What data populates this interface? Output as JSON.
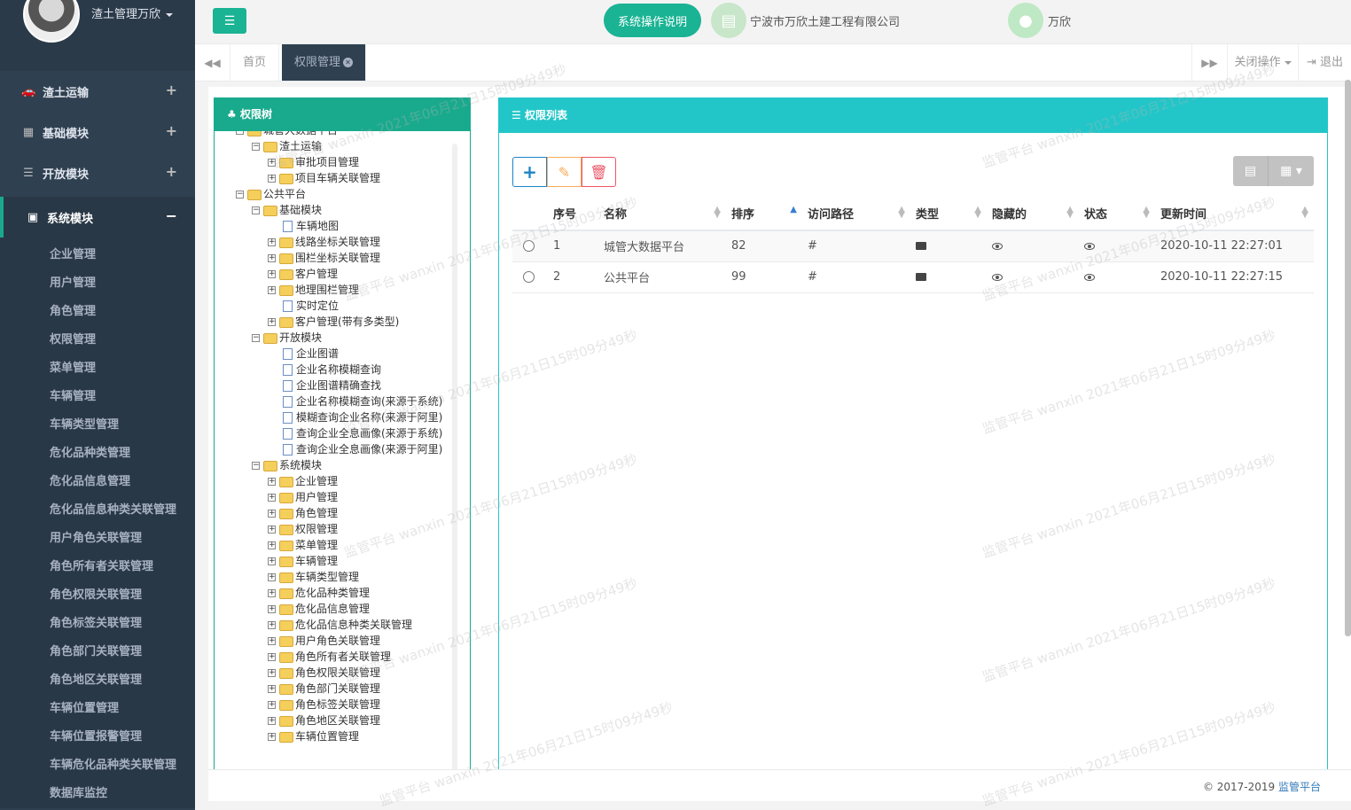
{
  "profile": {
    "name": "渣土管理万欣"
  },
  "sidebar": {
    "groups": [
      {
        "label": "渣土运输",
        "icon": "car-icon"
      },
      {
        "label": "基础模块",
        "icon": "qrcode-icon"
      },
      {
        "label": "开放模块",
        "icon": "bars-icon"
      },
      {
        "label": "系统模块",
        "icon": "system-icon"
      }
    ],
    "items": [
      "企业管理",
      "用户管理",
      "角色管理",
      "权限管理",
      "菜单管理",
      "车辆管理",
      "车辆类型管理",
      "危化品种类管理",
      "危化品信息管理",
      "危化品信息种类关联管理",
      "用户角色关联管理",
      "角色所有者关联管理",
      "角色权限关联管理",
      "角色标签关联管理",
      "角色部门关联管理",
      "角色地区关联管理",
      "车辆位置管理",
      "车辆位置报警管理",
      "车辆危化品种类关联管理",
      "数据库监控"
    ]
  },
  "header": {
    "help_label": "系统操作说明",
    "company": "宁波市万欣土建工程有限公司",
    "user": "万欣"
  },
  "tabs": {
    "home": "首页",
    "active": "权限管理",
    "close_ops": "关闭操作",
    "logout": "退出"
  },
  "tree": {
    "title": "权限树",
    "nodes": [
      "城管大数据平台",
      "渣土运输",
      "审批项目管理",
      "项目车辆关联管理",
      "公共平台",
      "基础模块",
      "车辆地图",
      "线路坐标关联管理",
      "围栏坐标关联管理",
      "客户管理",
      "地理围栏管理",
      "实时定位",
      "客户管理(带有多类型)",
      "开放模块",
      "企业图谱",
      "企业名称模糊查询",
      "企业图谱精确查找",
      "企业名称模糊查询(来源于系统)",
      "模糊查询企业名称(来源于阿里)",
      "查询企业全息画像(来源于系统)",
      "查询企业全息画像(来源于阿里)",
      "系统模块",
      "企业管理",
      "用户管理",
      "角色管理",
      "权限管理",
      "菜单管理",
      "车辆管理",
      "车辆类型管理",
      "危化品种类管理",
      "危化品信息管理",
      "危化品信息种类关联管理",
      "用户角色关联管理",
      "角色所有者关联管理",
      "角色权限关联管理",
      "角色部门关联管理",
      "角色标签关联管理",
      "角色地区关联管理",
      "车辆位置管理"
    ]
  },
  "list": {
    "title": "权限列表",
    "columns": [
      "序号",
      "名称",
      "排序",
      "访问路径",
      "类型",
      "隐藏的",
      "状态",
      "更新时间"
    ],
    "rows": [
      {
        "no": "1",
        "name": "城管大数据平台",
        "sort": "82",
        "path": "#",
        "time": "2020-10-11 22:27:01"
      },
      {
        "no": "2",
        "name": "公共平台",
        "sort": "99",
        "path": "#",
        "time": "2020-10-11 22:27:15"
      }
    ]
  },
  "footer": {
    "copyright": "© 2017-2019 ",
    "brand": "监管平台"
  },
  "watermark": "监管平台 wanxin 2021年06月21日15时09分49秒",
  "colors": {
    "primary": "#1ab394",
    "info": "#23c6c8",
    "sidebar": "#2f4050"
  }
}
